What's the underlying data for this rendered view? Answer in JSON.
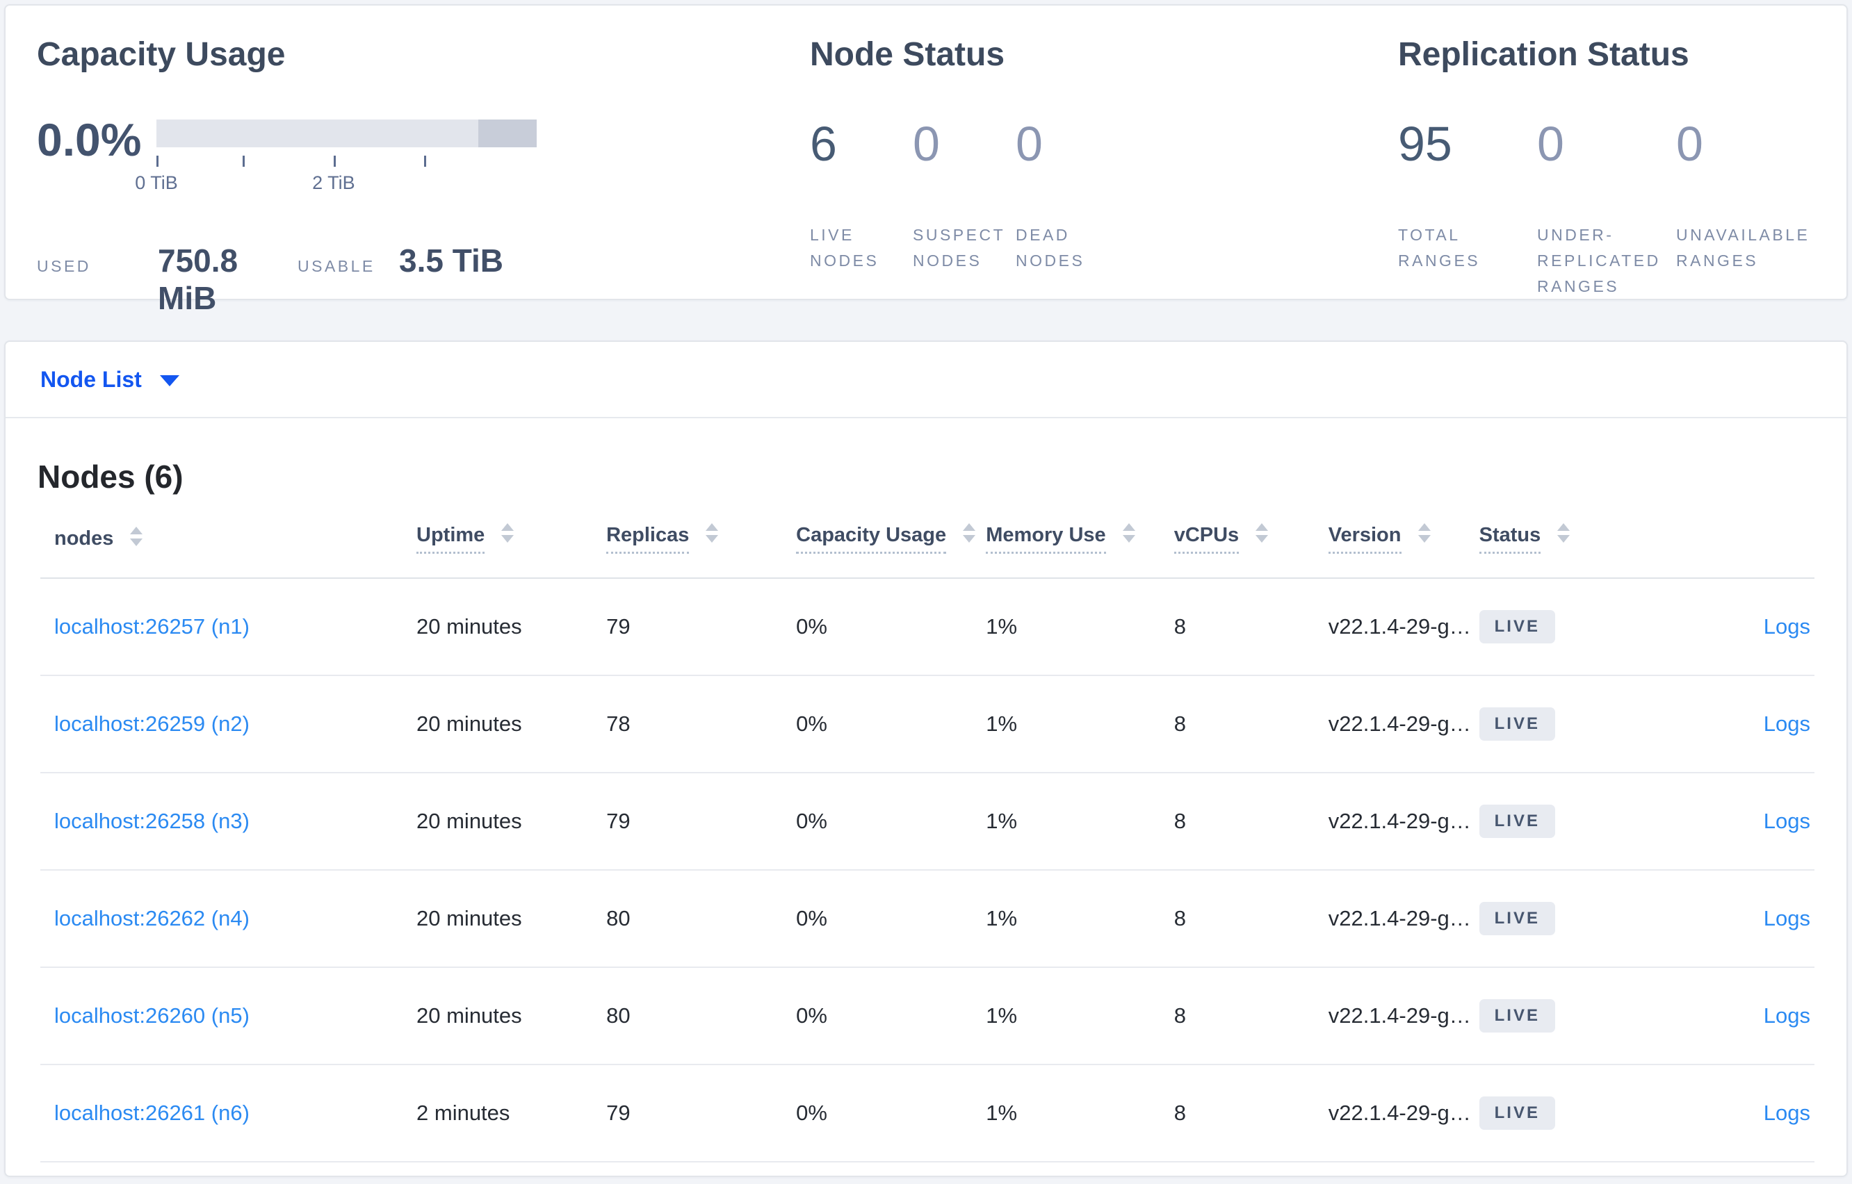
{
  "colors": {
    "accent_blue": "#1356f0",
    "link_blue": "#2b8af2",
    "badge_bg": "#e8ebf1",
    "badge_text": "#47566f",
    "stat_dark": "#475b74",
    "stat_muted": "#8b96b2",
    "bar_base": "#e2e5ec",
    "bar_dark_segment": "#c8cdd9"
  },
  "summary": {
    "capacity": {
      "title": "Capacity Usage",
      "percent": "0.0%",
      "axis_tick_0": "0 TiB",
      "axis_tick_2": "2 TiB",
      "bar_dark_segment_width_pct": 15.4,
      "used_label": "USED",
      "used_value": "750.8 MiB",
      "usable_label": "USABLE",
      "usable_value": "3.5 TiB"
    },
    "node_status": {
      "title": "Node Status",
      "stats": [
        {
          "value": "6",
          "label": "LIVE NODES"
        },
        {
          "value": "0",
          "label": "SUSPECT NODES"
        },
        {
          "value": "0",
          "label": "DEAD NODES"
        }
      ]
    },
    "replication": {
      "title": "Replication Status",
      "stats": [
        {
          "value": "95",
          "label": "TOTAL RANGES"
        },
        {
          "value": "0",
          "label": "UNDER-REPLICATED RANGES"
        },
        {
          "value": "0",
          "label": "UNAVAILABLE RANGES"
        }
      ]
    }
  },
  "node_list": {
    "dropdown_label": "Node List",
    "heading": "Nodes (6)",
    "columns": [
      "nodes",
      "Uptime",
      "Replicas",
      "Capacity Usage",
      "Memory Use",
      "vCPUs",
      "Version",
      "Status"
    ],
    "rows": [
      {
        "node": "localhost:26257 (n1)",
        "uptime": "20 minutes",
        "replicas": "79",
        "capacity": "0%",
        "memory": "1%",
        "vcpus": "8",
        "version": "v22.1.4-29-g…",
        "status": "LIVE",
        "logs": "Logs"
      },
      {
        "node": "localhost:26259 (n2)",
        "uptime": "20 minutes",
        "replicas": "78",
        "capacity": "0%",
        "memory": "1%",
        "vcpus": "8",
        "version": "v22.1.4-29-g…",
        "status": "LIVE",
        "logs": "Logs"
      },
      {
        "node": "localhost:26258 (n3)",
        "uptime": "20 minutes",
        "replicas": "79",
        "capacity": "0%",
        "memory": "1%",
        "vcpus": "8",
        "version": "v22.1.4-29-g…",
        "status": "LIVE",
        "logs": "Logs"
      },
      {
        "node": "localhost:26262 (n4)",
        "uptime": "20 minutes",
        "replicas": "80",
        "capacity": "0%",
        "memory": "1%",
        "vcpus": "8",
        "version": "v22.1.4-29-g…",
        "status": "LIVE",
        "logs": "Logs"
      },
      {
        "node": "localhost:26260 (n5)",
        "uptime": "20 minutes",
        "replicas": "80",
        "capacity": "0%",
        "memory": "1%",
        "vcpus": "8",
        "version": "v22.1.4-29-g…",
        "status": "LIVE",
        "logs": "Logs"
      },
      {
        "node": "localhost:26261 (n6)",
        "uptime": "2 minutes",
        "replicas": "79",
        "capacity": "0%",
        "memory": "1%",
        "vcpus": "8",
        "version": "v22.1.4-29-g…",
        "status": "LIVE",
        "logs": "Logs"
      }
    ]
  }
}
